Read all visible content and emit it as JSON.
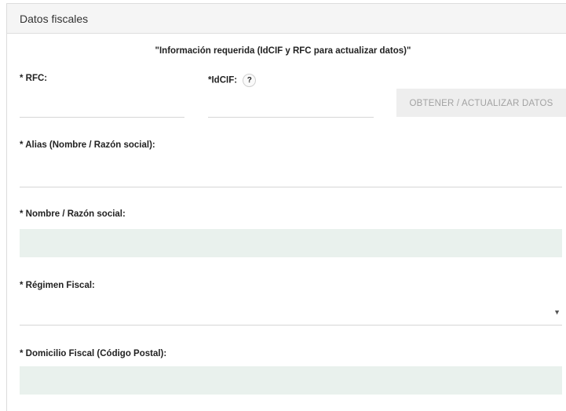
{
  "panel": {
    "title": "Datos fiscales"
  },
  "notice": "\"Información requerida (IdCIF y RFC para actualizar datos)\"",
  "fields": {
    "rfc": {
      "label": "* RFC:",
      "value": ""
    },
    "idcif": {
      "label": "*IdCIF:",
      "help": "?",
      "value": ""
    },
    "alias": {
      "label": "* Alias (Nombre / Razón social):",
      "value": ""
    },
    "nombre": {
      "label": "* Nombre / Razón social:",
      "value": ""
    },
    "regimen": {
      "label": "* Régimen Fiscal:",
      "selected": ""
    },
    "domicilio": {
      "label": "* Domicilio Fiscal (Código Postal):",
      "value": ""
    }
  },
  "buttons": {
    "obtener": "OBTENER / ACTUALIZAR DATOS"
  },
  "colors": {
    "header_bg": "#f5f5f5",
    "readonly_bg": "#e9f1ed",
    "button_bg": "#eeeeee",
    "button_text": "#a2a2a2"
  }
}
